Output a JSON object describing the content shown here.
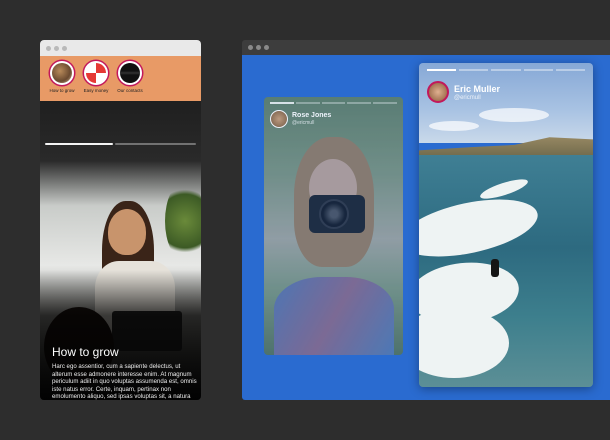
{
  "mobile": {
    "stories": [
      {
        "label": "How to grow"
      },
      {
        "label": "Easy money"
      },
      {
        "label": "Our contacts"
      }
    ],
    "active_story": {
      "title": "How to grow",
      "description": "Harc ego assentior, cum a sapiente delectus, ut alterum esse admonere interesse enim. At magnum periculum adiit in quo voluptas assumenda est, omnis iste natus error. Certe, inquam, pertinax non emolumento aliquo, sed ipsas voluptas sit, a natura ipsa. At vero eos et benivole collegisti, nec voluptas assumenda est."
    },
    "progress_fraction": 0.45
  },
  "desktop": {
    "cards": [
      {
        "name": "Rose Jones",
        "handle": "@ericmull"
      },
      {
        "name": "Eric Muller",
        "handle": "@ericmull"
      }
    ]
  },
  "colors": {
    "background": "#2d2d2d",
    "stories_bar": "#e89a66",
    "desktop_blue": "#2a6bd0",
    "story_ring": "#c2185b"
  }
}
